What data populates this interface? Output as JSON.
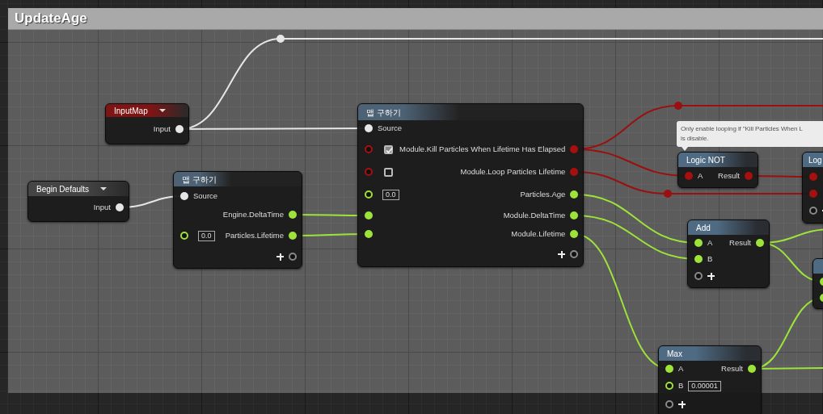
{
  "comment": {
    "title": "UpdateAge"
  },
  "nodes": [
    {
      "kind": "input_map",
      "title": "InputMap",
      "color": "#7e1414",
      "dropdown": true,
      "rows": [
        {
          "out_label": "Input",
          "out": {
            "kind": "param"
          }
        }
      ]
    },
    {
      "kind": "input_map",
      "title": "Begin Defaults",
      "color": "#454545",
      "dropdown": true,
      "rows": [
        {
          "out_label": "Input",
          "out": {
            "kind": "param"
          }
        }
      ]
    },
    {
      "kind": "map_get",
      "title": "맵 구하기",
      "color": "#4d6275",
      "rows": [
        {
          "in": {
            "kind": "param",
            "connected": true
          },
          "in_label": "Source"
        },
        {
          "out_label": "Engine.DeltaTime",
          "out": {
            "kind": "float"
          }
        },
        {
          "in": {
            "kind": "float",
            "connected": false
          },
          "value": "0.0",
          "out_label": "Particles.Lifetime",
          "out": {
            "kind": "float"
          }
        },
        {
          "out": {
            "kind": "add"
          }
        }
      ]
    },
    {
      "kind": "map_get",
      "title": "맵 구하기",
      "color": "#4d6275",
      "rows": [
        {
          "in": {
            "kind": "param",
            "connected": true
          },
          "in_label": "Source"
        },
        {
          "in": {
            "kind": "bool",
            "connected": false
          },
          "checked": true,
          "out_label": "Module.Kill Particles When Lifetime Has Elapsed",
          "out": {
            "kind": "bool"
          }
        },
        {
          "in": {
            "kind": "bool",
            "connected": false
          },
          "checked": false,
          "out_label": "Module.Loop Particles Lifetime",
          "out": {
            "kind": "bool"
          }
        },
        {
          "in": {
            "kind": "float",
            "connected": false
          },
          "value": "0.0",
          "out_label": "Particles.Age",
          "out": {
            "kind": "float"
          }
        },
        {
          "in": {
            "kind": "float",
            "connected": true
          },
          "out_label": "Module.DeltaTime",
          "out": {
            "kind": "float"
          }
        },
        {
          "in": {
            "kind": "float",
            "connected": true
          },
          "out_label": "Module.Lifetime",
          "out": {
            "kind": "float"
          }
        },
        {
          "out": {
            "kind": "add"
          }
        }
      ]
    },
    {
      "kind": "function",
      "title": "Logic NOT",
      "color": "#4f6b84",
      "rows": [
        {
          "in": {
            "kind": "bool",
            "connected": true
          },
          "in_label": "A",
          "out_label": "Result",
          "out": {
            "kind": "bool"
          }
        }
      ]
    },
    {
      "kind": "function",
      "title": "Log",
      "color": "#4f6b84",
      "rows": [
        {
          "in": {
            "kind": "bool",
            "connected": true
          }
        },
        {
          "in": {
            "kind": "bool",
            "connected": true
          }
        },
        {
          "in": {
            "kind": "add"
          }
        }
      ]
    },
    {
      "kind": "function",
      "title": "Add",
      "color": "#4f6b84",
      "rows": [
        {
          "in": {
            "kind": "float",
            "connected": true
          },
          "in_label": "A",
          "out_label": "Result",
          "out": {
            "kind": "float"
          }
        },
        {
          "in": {
            "kind": "float",
            "connected": true
          },
          "in_label": "B"
        },
        {
          "in": {
            "kind": "add"
          }
        }
      ]
    },
    {
      "kind": "function",
      "color": "#4f6b84",
      "rows": [
        {
          "in": {
            "kind": "float",
            "connected": true
          }
        },
        {
          "in": {
            "kind": "float",
            "connected": true
          }
        }
      ]
    },
    {
      "kind": "function",
      "title": "Max",
      "color": "#4f6b84",
      "rows": [
        {
          "in": {
            "kind": "float",
            "connected": true
          },
          "in_label": "A",
          "out_label": "Result",
          "out": {
            "kind": "float"
          }
        },
        {
          "in": {
            "kind": "float",
            "connected": false
          },
          "in_label": "B",
          "value": "0.00001"
        },
        {
          "in": {
            "kind": "add"
          }
        }
      ]
    }
  ],
  "bubble": {
    "lines": [
      "Only enable looping if \"Kill Particles When L",
      "is disable."
    ]
  }
}
